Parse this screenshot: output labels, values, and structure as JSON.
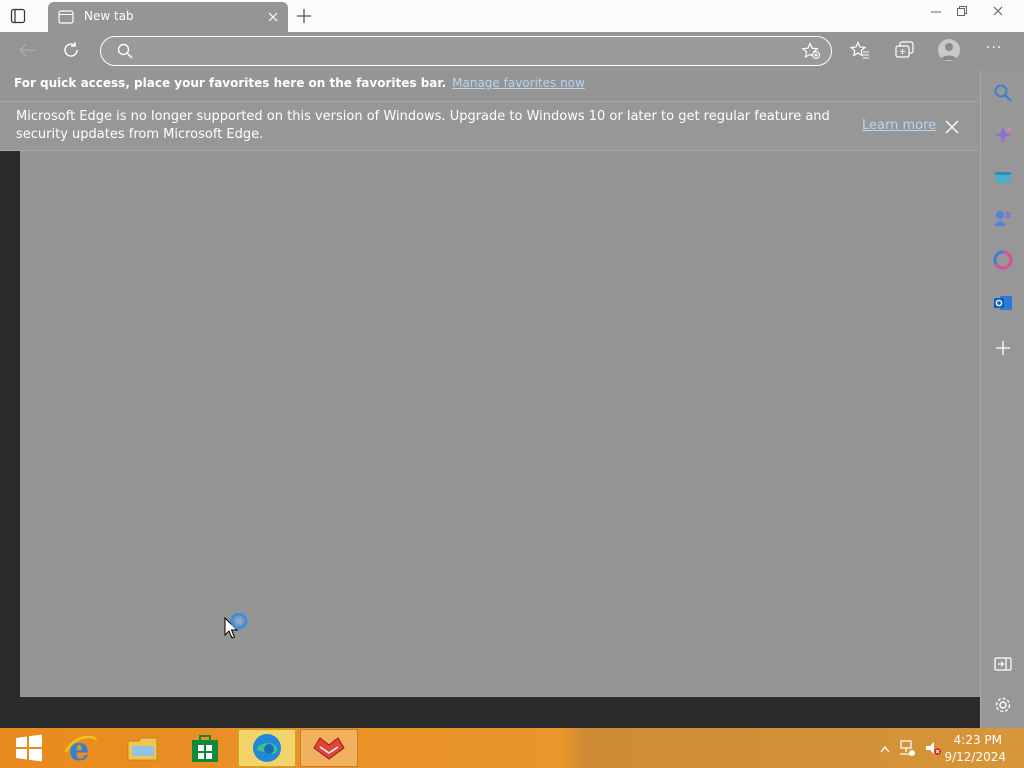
{
  "tab": {
    "title": "New tab"
  },
  "address_bar": {
    "value": "",
    "placeholder": ""
  },
  "favorites_bar": {
    "message": "For quick access, place your favorites here on the favorites bar.",
    "manage_link": "Manage favorites now"
  },
  "infobar": {
    "message": "Microsoft Edge is no longer supported on this version of Windows. Upgrade to Windows 10 or later to get regular feature and security updates from Microsoft Edge.",
    "learn_more": "Learn more"
  },
  "sidebar": {
    "items": [
      "search-icon",
      "copilot-icon",
      "shopping-icon",
      "games-icon",
      "microsoft-365-icon",
      "outlook-icon",
      "add-icon"
    ],
    "bottom": [
      "hide-sidebar-icon",
      "settings-icon"
    ]
  },
  "taskbar": {
    "items": [
      "start-button",
      "internet-explorer",
      "file-explorer",
      "store",
      "microsoft-edge",
      "app"
    ],
    "clock": {
      "time": "4:23 PM",
      "date": "9/12/2024"
    }
  },
  "colors": {
    "taskbar": "#e98a20",
    "overlay": "#959595",
    "link": "#b7d4ef"
  }
}
